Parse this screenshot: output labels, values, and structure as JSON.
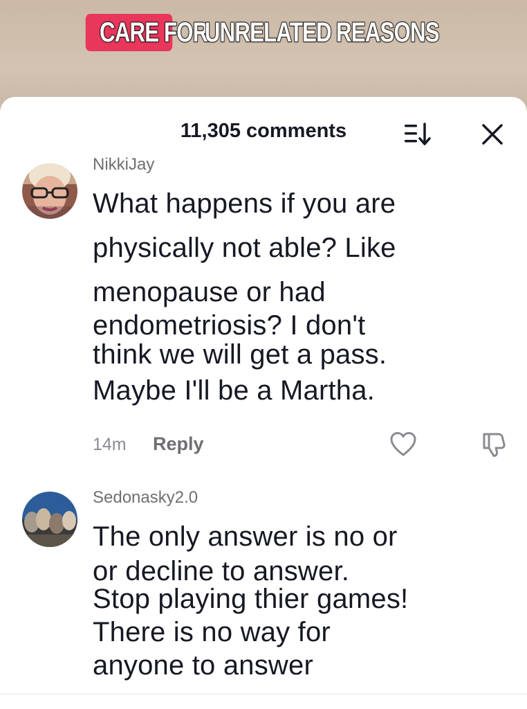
{
  "video": {
    "caption_words": [
      "CARE",
      "FOR",
      "UNRELATED",
      "REASONS"
    ],
    "caption_highlight_color": "#e8375b"
  },
  "sheet": {
    "comment_count_label": "11,305 comments",
    "sort_icon": "sort-icon",
    "close_icon": "close-icon"
  },
  "comments": [
    {
      "username": "NikkiJay",
      "text_lines": [
        "What happens if you are",
        "physically not able? Like",
        "menopause or had",
        "endometriosis? I don't",
        "think we will get a pass.",
        "Maybe I'll be a Martha."
      ],
      "time": "14m",
      "reply_label": "Reply"
    },
    {
      "username": "Sedonasky2.0",
      "text_lines": [
        "The only answer is no or",
        "or decline to answer.",
        "Stop playing thier games!",
        "There is no way for",
        "anyone to answer"
      ]
    }
  ]
}
